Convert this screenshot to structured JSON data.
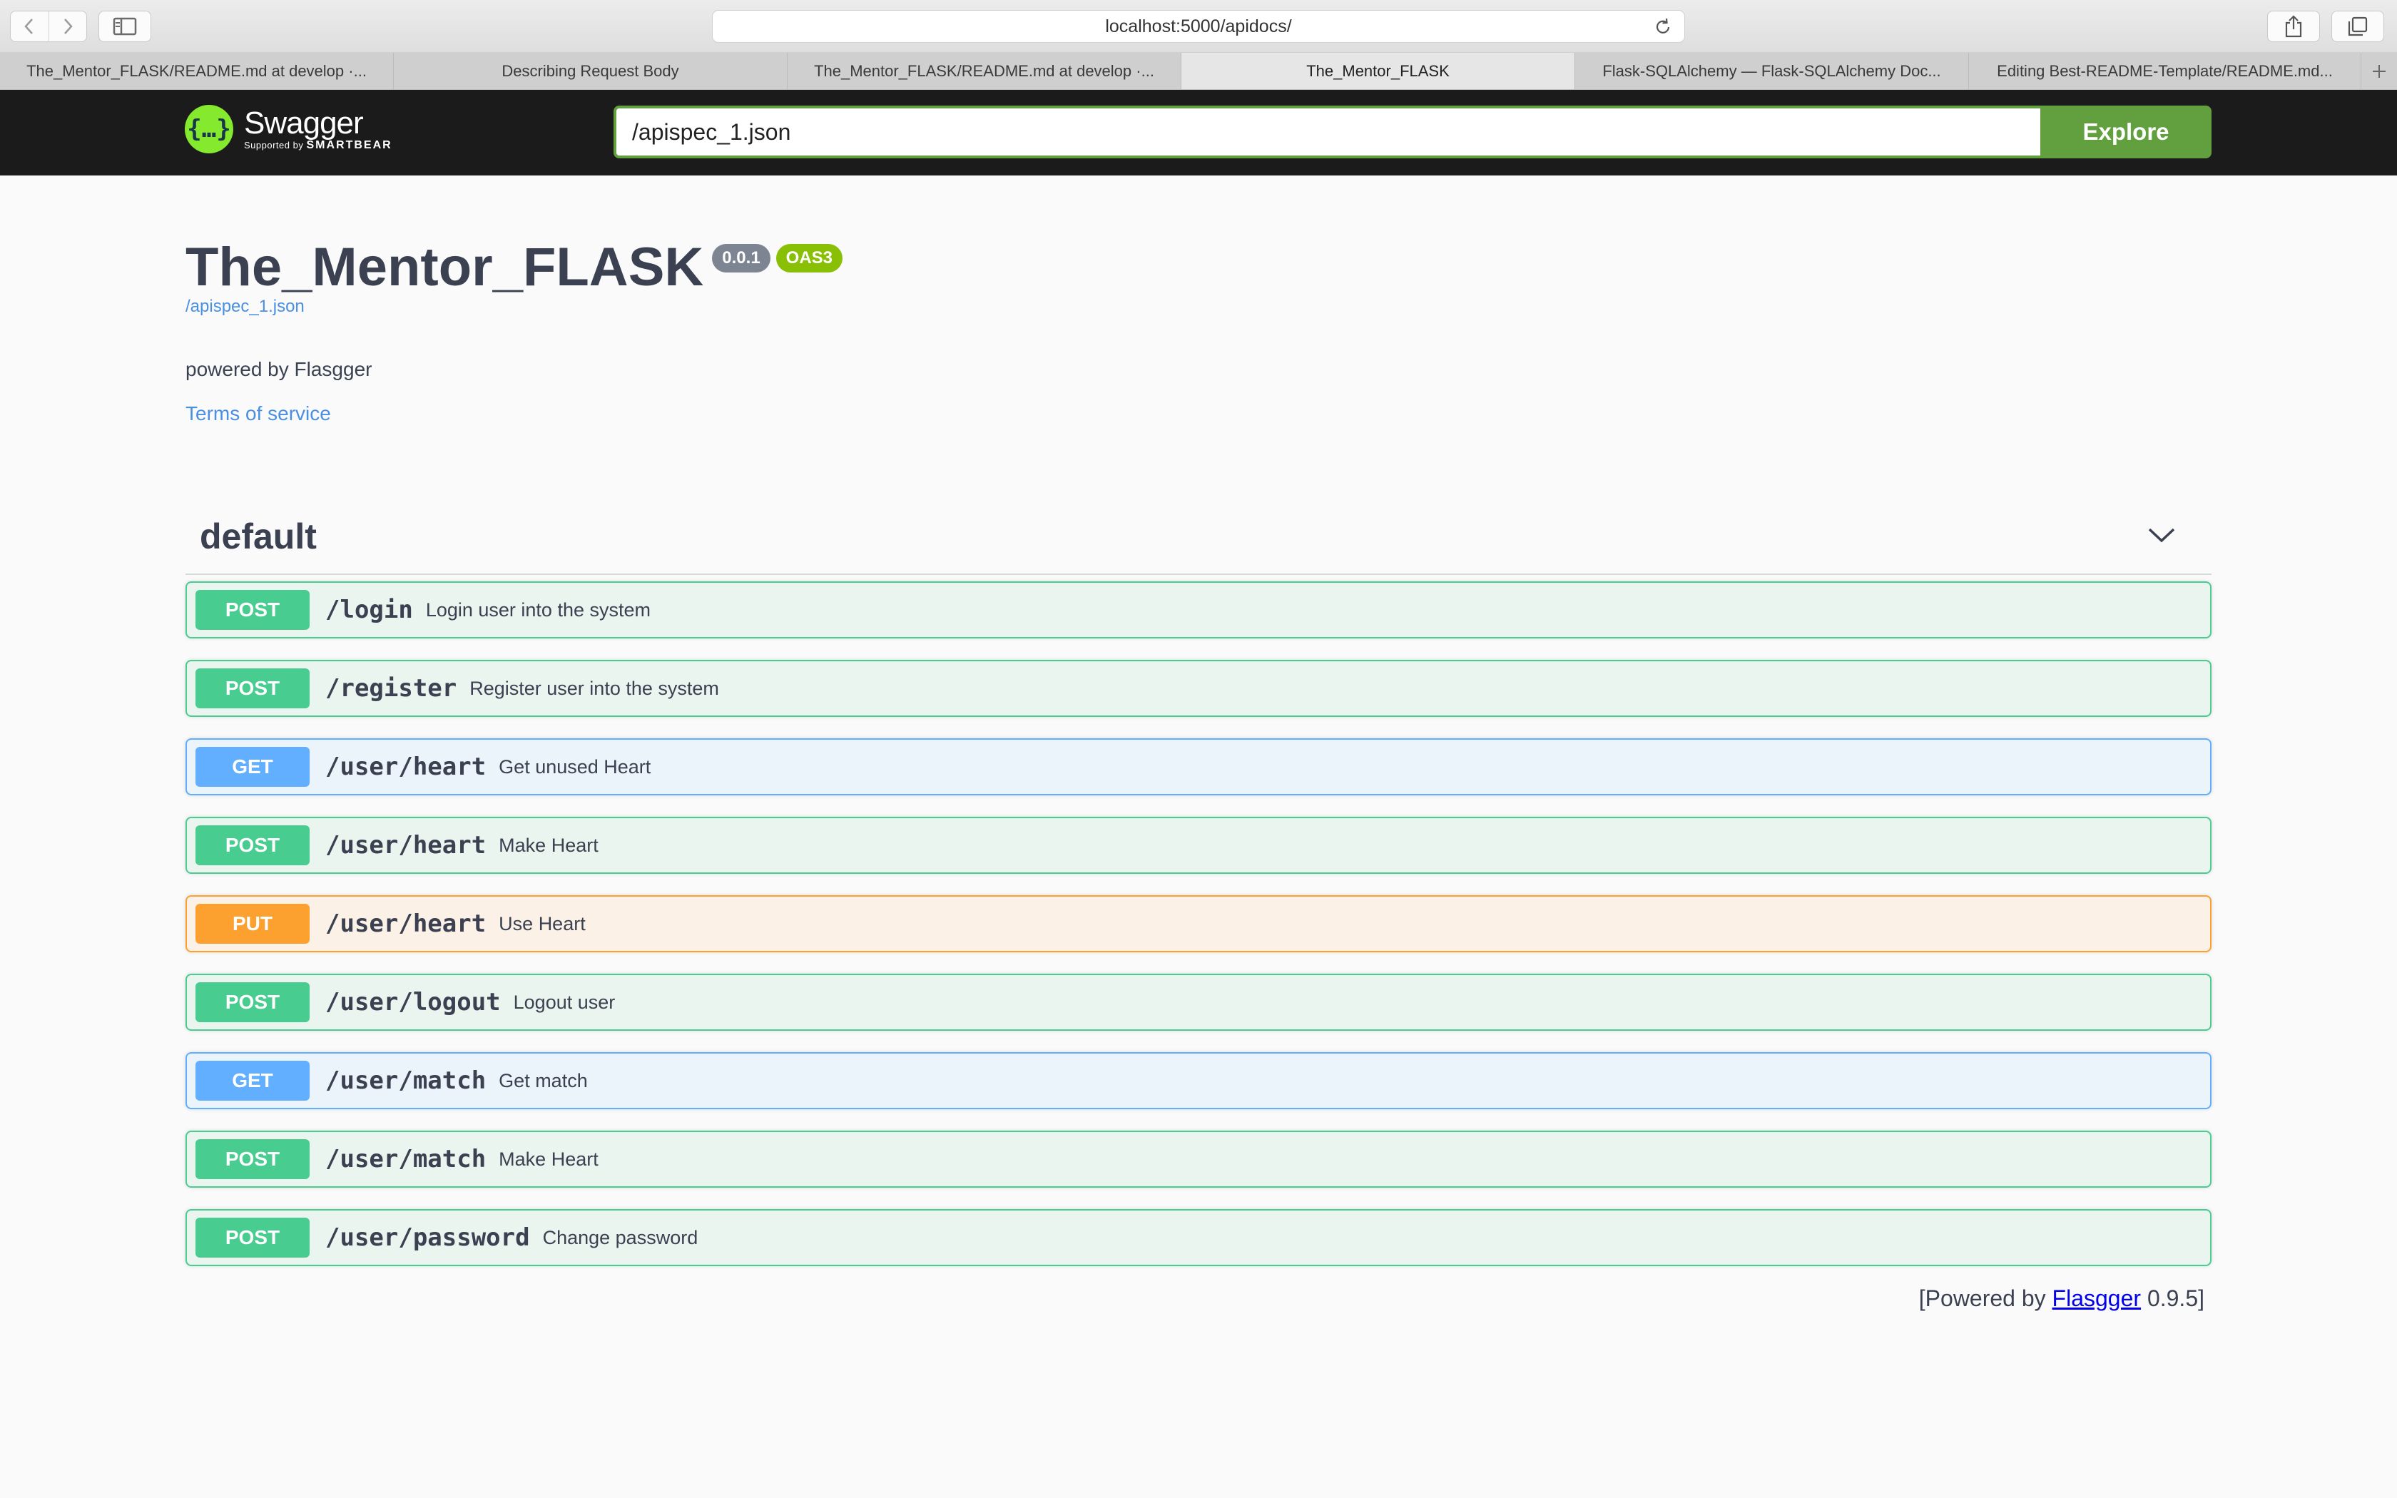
{
  "browser": {
    "url": "localhost:5000/apidocs/",
    "tabs": [
      {
        "label": "The_Mentor_FLASK/README.md at develop ·...",
        "active": false
      },
      {
        "label": "Describing Request Body",
        "active": false
      },
      {
        "label": "The_Mentor_FLASK/README.md at develop ·...",
        "active": false
      },
      {
        "label": "The_Mentor_FLASK",
        "active": true
      },
      {
        "label": "Flask-SQLAlchemy — Flask-SQLAlchemy Doc...",
        "active": false
      },
      {
        "label": "Editing Best-README-Template/README.md...",
        "active": false
      }
    ]
  },
  "topbar": {
    "logo_name": "Swagger",
    "logo_supported": "Supported by",
    "logo_brand": "SMARTBEAR",
    "spec_url": "/apispec_1.json",
    "explore_label": "Explore"
  },
  "info": {
    "title": "The_Mentor_FLASK",
    "version": "0.0.1",
    "oas": "OAS3",
    "spec_link": "/apispec_1.json",
    "description": "powered by Flasgger",
    "terms": "Terms of service"
  },
  "section": {
    "title": "default"
  },
  "operations": [
    {
      "method": "POST",
      "path": "/login",
      "summary": "Login user into the system"
    },
    {
      "method": "POST",
      "path": "/register",
      "summary": "Register user into the system"
    },
    {
      "method": "GET",
      "path": "/user/heart",
      "summary": "Get unused Heart"
    },
    {
      "method": "POST",
      "path": "/user/heart",
      "summary": "Make Heart"
    },
    {
      "method": "PUT",
      "path": "/user/heart",
      "summary": "Use Heart"
    },
    {
      "method": "POST",
      "path": "/user/logout",
      "summary": "Logout user"
    },
    {
      "method": "GET",
      "path": "/user/match",
      "summary": "Get match"
    },
    {
      "method": "POST",
      "path": "/user/match",
      "summary": "Make Heart"
    },
    {
      "method": "POST",
      "path": "/user/password",
      "summary": "Change password"
    }
  ],
  "footer": {
    "prefix": "[Powered by ",
    "link": "Flasgger",
    "suffix": " 0.9.5]"
  },
  "colors": {
    "post": "#49cc90",
    "get": "#61affe",
    "put": "#fca130",
    "explore": "#62a03f",
    "oas_badge": "#89bf04"
  }
}
